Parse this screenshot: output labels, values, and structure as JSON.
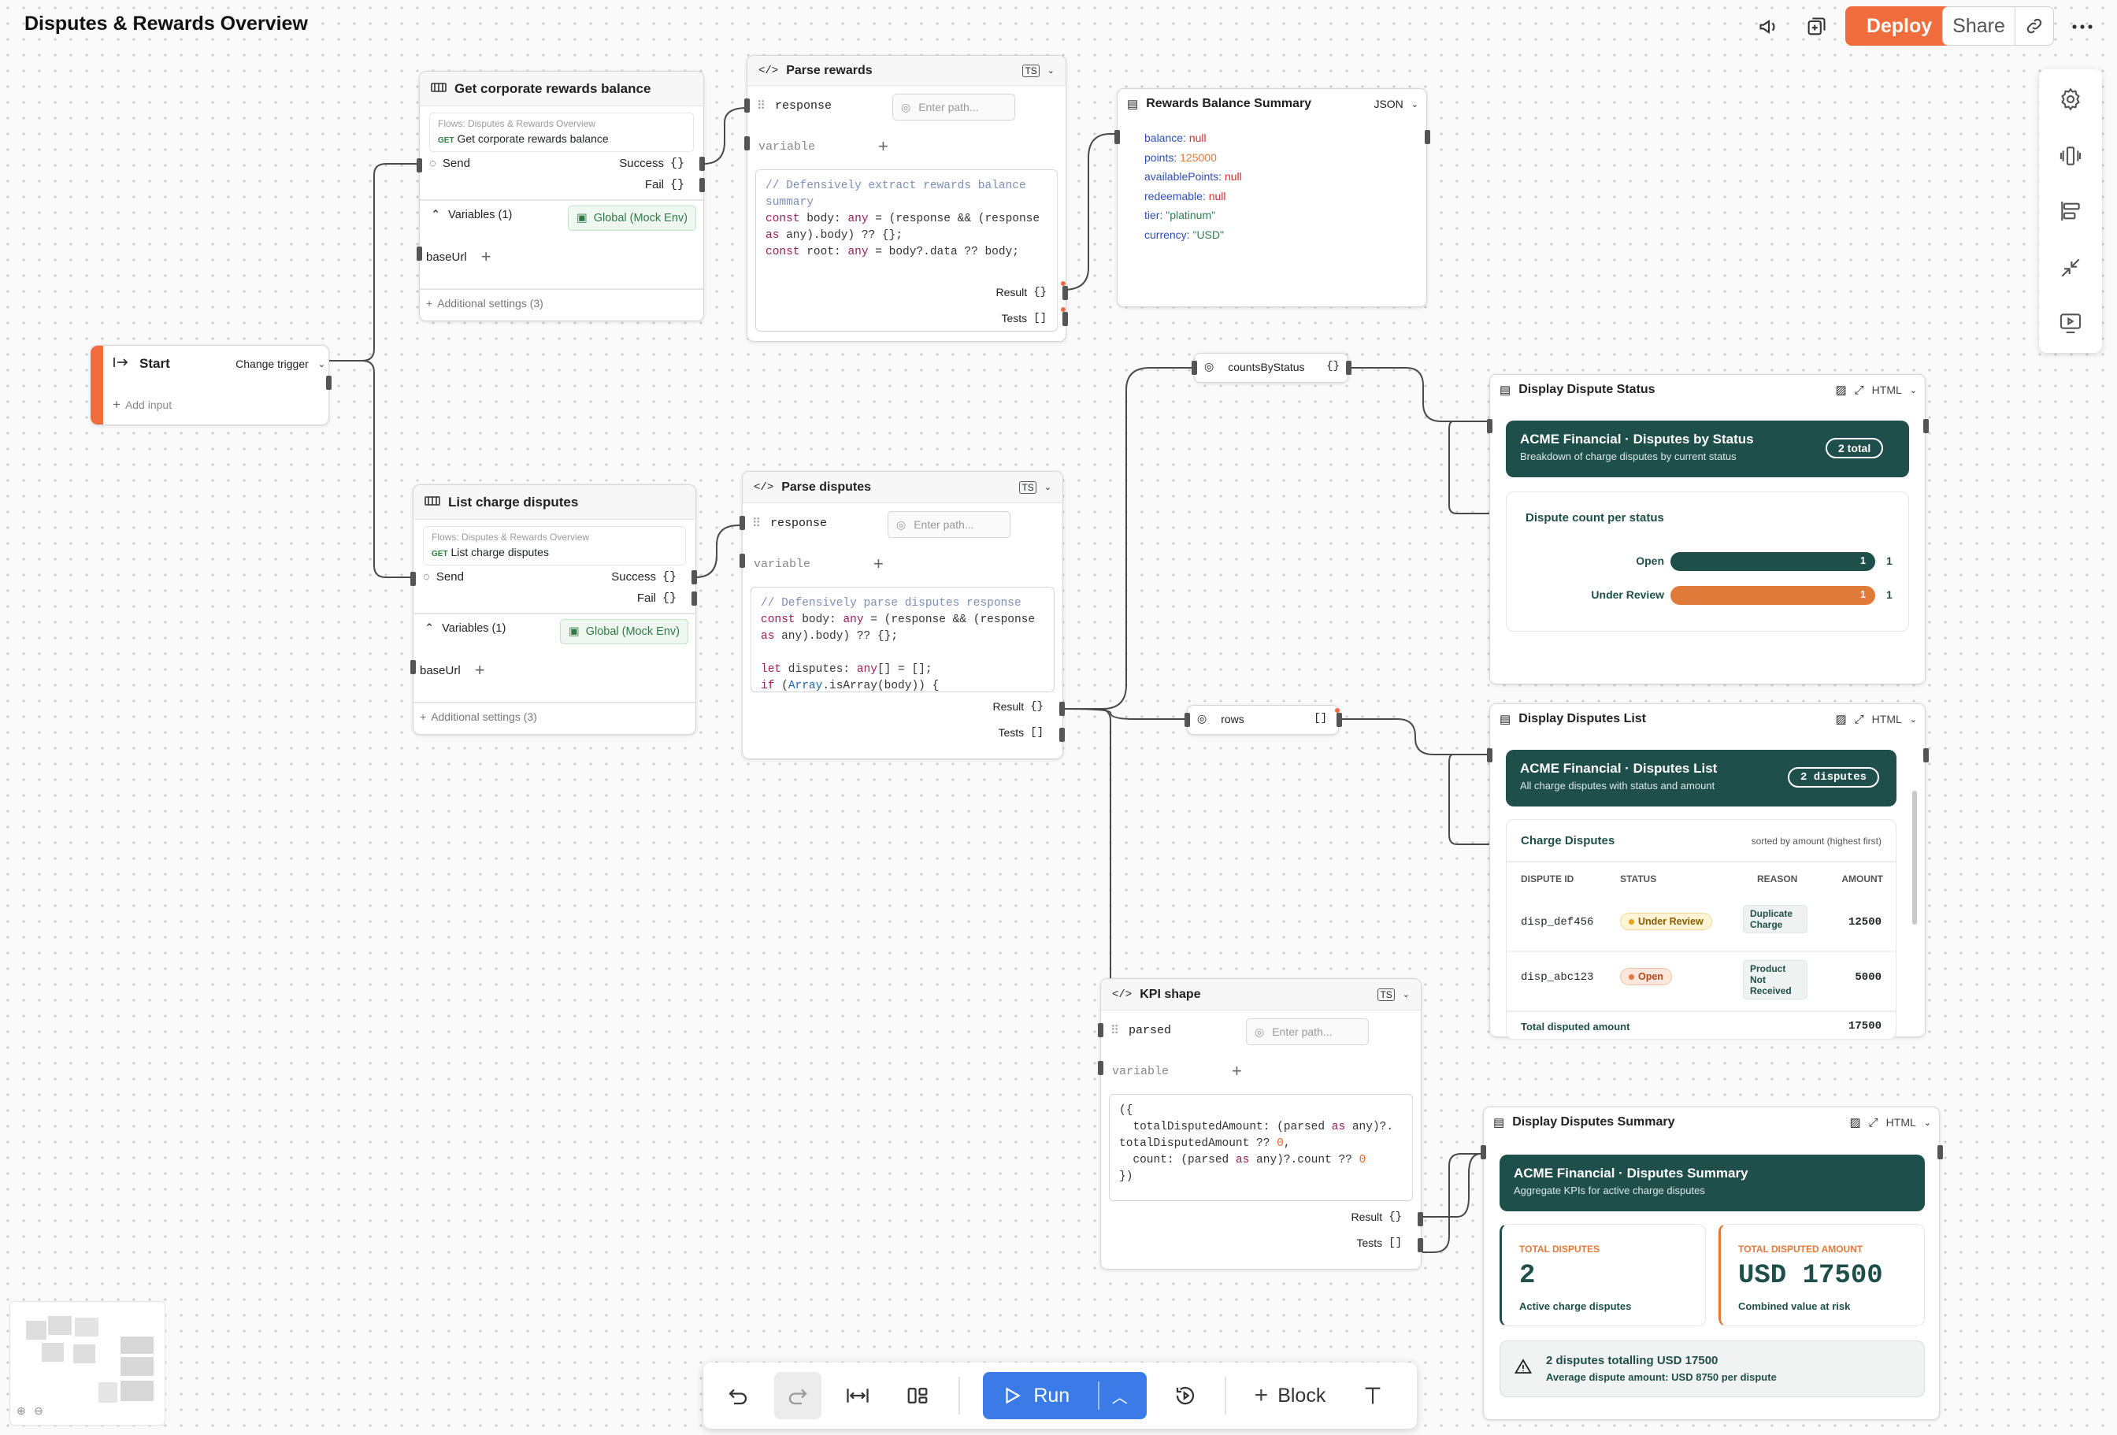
{
  "header": {
    "title": "Disputes & Rewards Overview",
    "deploy_label": "Deploy",
    "share_label": "Share",
    "icons": [
      "megaphone-icon",
      "add-page-icon",
      "link-icon",
      "more-icon"
    ]
  },
  "start": {
    "title": "Start",
    "trigger": "Change trigger",
    "add_input": "Add input"
  },
  "rewards_api": {
    "title": "Get corporate rewards balance",
    "crumb": "Flows: Disputes & Rewards Overview",
    "method": "GET",
    "endpoint": "Get corporate rewards balance",
    "send": "Send",
    "success": "Success",
    "fail": "Fail",
    "variables": "Variables (1)",
    "env": "Global (Mock Env)",
    "var_name": "baseUrl",
    "additional": "Additional settings (3)"
  },
  "disputes_api": {
    "title": "List charge disputes",
    "crumb": "Flows: Disputes & Rewards Overview",
    "method": "GET",
    "endpoint": "List charge disputes",
    "send": "Send",
    "success": "Success",
    "fail": "Fail",
    "variables": "Variables (1)",
    "env": "Global (Mock Env)",
    "var_name": "baseUrl",
    "additional": "Additional settings (3)"
  },
  "parse_rewards": {
    "title": "Parse rewards",
    "input": "response",
    "placeholder": "Enter path...",
    "variable": "variable",
    "result": "Result",
    "tests": "Tests"
  },
  "parse_disputes": {
    "title": "Parse disputes",
    "input": "response",
    "placeholder": "Enter path...",
    "variable": "variable",
    "result": "Result",
    "tests": "Tests"
  },
  "kpi": {
    "title": "KPI shape",
    "input": "parsed",
    "placeholder": "Enter path...",
    "variable": "variable",
    "result": "Result",
    "tests": "Tests"
  },
  "rewards_summary": {
    "title": "Rewards Balance Summary",
    "format": "JSON",
    "fields": [
      {
        "key": "balance:",
        "val": "null"
      },
      {
        "key": "points:",
        "val": "125000"
      },
      {
        "key": "availablePoints:",
        "val": "null"
      },
      {
        "key": "redeemable:",
        "val": "null"
      },
      {
        "key": "tier:",
        "val": "\"platinum\""
      },
      {
        "key": "currency:",
        "val": "\"USD\""
      }
    ]
  },
  "chips": {
    "counts": "countsByStatus",
    "rows": "rows"
  },
  "dispute_status": {
    "title": "Display Dispute Status",
    "format": "HTML",
    "banner_title": "ACME Financial · Disputes by Status",
    "banner_sub": "Breakdown of charge disputes by current status",
    "total": "2 total",
    "card_title": "Dispute count per status",
    "bars": [
      {
        "label": "Open",
        "value": 1,
        "fill": 1.0,
        "color": "#1f4f4a"
      },
      {
        "label": "Under Review",
        "value": 1,
        "fill": 1.0,
        "color": "#e07a3a"
      }
    ]
  },
  "disputes_list": {
    "title": "Display Disputes List",
    "format": "HTML",
    "banner_title": "ACME Financial · Disputes List",
    "banner_sub": "All charge disputes with status and amount",
    "count": "2 disputes",
    "card_title": "Charge Disputes",
    "sort_note": "sorted by amount (highest first)",
    "columns": [
      "DISPUTE ID",
      "STATUS",
      "REASON",
      "AMOUNT"
    ],
    "rows": [
      {
        "id": "disp_def456",
        "status": "Under Review",
        "reason": "Duplicate Charge",
        "amount": "12500"
      },
      {
        "id": "disp_abc123",
        "status": "Open",
        "reason": "Product Not Received",
        "amount": "5000"
      }
    ],
    "total_label": "Total disputed amount",
    "total_value": "17500"
  },
  "disputes_summary": {
    "title": "Display Disputes Summary",
    "format": "HTML",
    "banner_title": "ACME Financial · Disputes Summary",
    "banner_sub": "Aggregate KPIs for active charge disputes",
    "kpi1_label": "TOTAL DISPUTES",
    "kpi1_value": "2",
    "kpi1_sub": "Active charge disputes",
    "kpi2_label": "TOTAL DISPUTED AMOUNT",
    "kpi2_value": "USD 17500",
    "kpi2_sub": "Combined value at risk",
    "alert_title": "2 disputes totalling USD 17500",
    "alert_sub": "Average dispute amount: USD 8750 per dispute"
  },
  "toolbar": {
    "run": "Run",
    "block": "Block"
  },
  "colors": {
    "accent": "#f26d3d",
    "run": "#3b7be8",
    "teal": "#1f4f4a",
    "orange": "#e07a3a"
  }
}
